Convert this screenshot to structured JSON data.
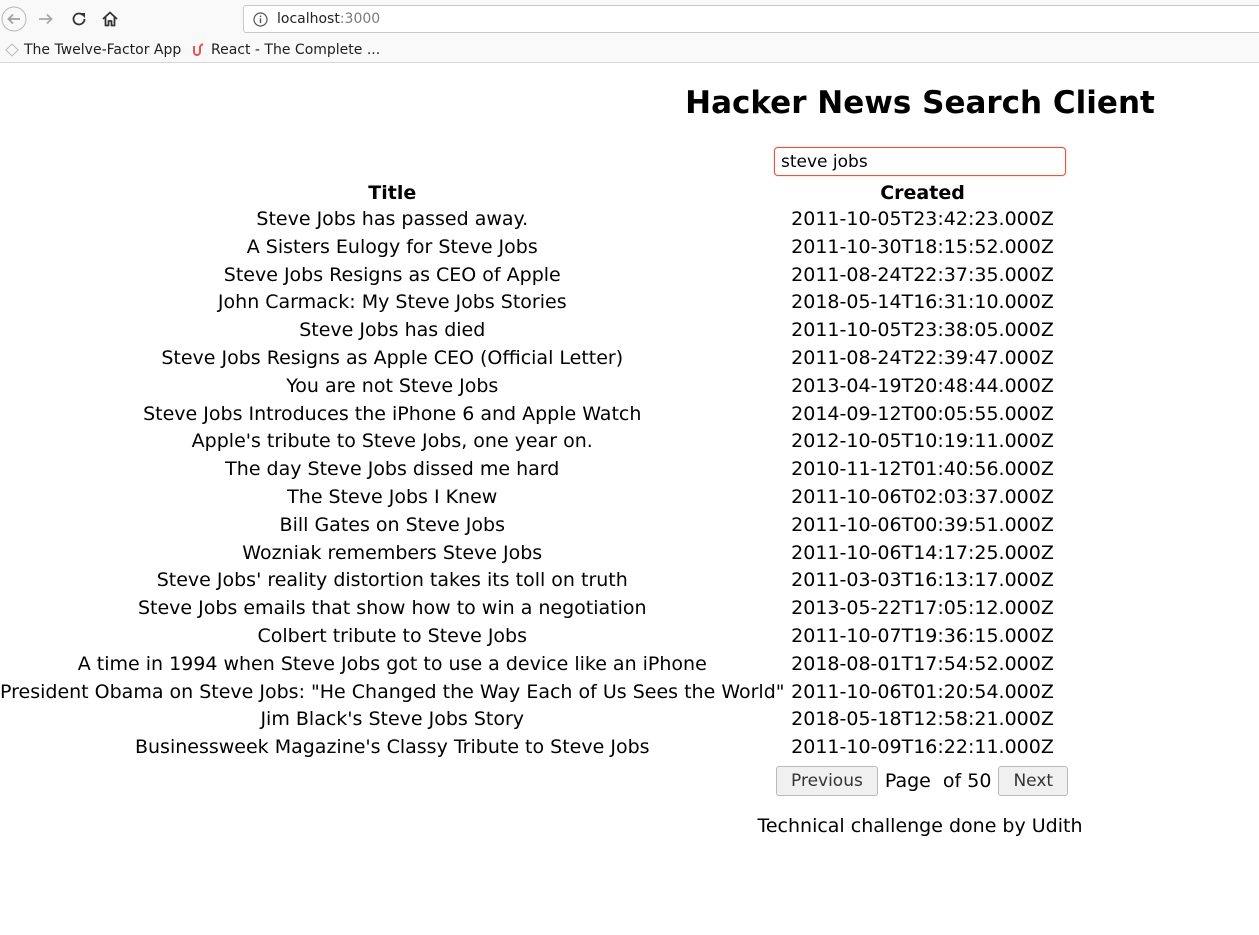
{
  "browser": {
    "url_host": "localhost",
    "url_port": ":3000",
    "bookmarks": [
      {
        "label": "The Twelve-Factor App",
        "icon": "twelve-factor-icon"
      },
      {
        "label": "React - The Complete ...",
        "icon": "udemy-icon"
      }
    ]
  },
  "app": {
    "title": "Hacker News Search Client",
    "search": {
      "value": "steve jobs"
    },
    "table": {
      "headers": {
        "title": "Title",
        "created": "Created"
      },
      "rows": [
        {
          "title": "Steve Jobs has passed away.",
          "created": "2011-10-05T23:42:23.000Z"
        },
        {
          "title": "A Sisters Eulogy for Steve Jobs",
          "created": "2011-10-30T18:15:52.000Z"
        },
        {
          "title": "Steve Jobs Resigns as CEO of Apple",
          "created": "2011-08-24T22:37:35.000Z"
        },
        {
          "title": "John Carmack: My Steve Jobs Stories",
          "created": "2018-05-14T16:31:10.000Z"
        },
        {
          "title": "Steve Jobs has died",
          "created": "2011-10-05T23:38:05.000Z"
        },
        {
          "title": "Steve Jobs Resigns as Apple CEO (Official Letter)",
          "created": "2011-08-24T22:39:47.000Z"
        },
        {
          "title": "You are not Steve Jobs",
          "created": "2013-04-19T20:48:44.000Z"
        },
        {
          "title": "Steve Jobs Introduces the iPhone 6 and Apple Watch",
          "created": "2014-09-12T00:05:55.000Z"
        },
        {
          "title": "Apple's tribute to Steve Jobs, one year on.",
          "created": "2012-10-05T10:19:11.000Z"
        },
        {
          "title": "The day Steve Jobs dissed me hard",
          "created": "2010-11-12T01:40:56.000Z"
        },
        {
          "title": "The Steve Jobs I Knew",
          "created": "2011-10-06T02:03:37.000Z"
        },
        {
          "title": "Bill Gates on Steve Jobs",
          "created": "2011-10-06T00:39:51.000Z"
        },
        {
          "title": "Wozniak remembers Steve Jobs",
          "created": "2011-10-06T14:17:25.000Z"
        },
        {
          "title": "Steve Jobs' reality distortion takes its toll on truth",
          "created": "2011-03-03T16:13:17.000Z"
        },
        {
          "title": "Steve Jobs emails that show how to win a negotiation",
          "created": "2013-05-22T17:05:12.000Z"
        },
        {
          "title": "Colbert tribute to Steve Jobs",
          "created": "2011-10-07T19:36:15.000Z"
        },
        {
          "title": "A time in 1994 when Steve Jobs got to use a device like an iPhone",
          "created": "2018-08-01T17:54:52.000Z"
        },
        {
          "title": "President Obama on Steve Jobs: \"He Changed the Way Each of Us Sees the World\"",
          "created": "2011-10-06T01:20:54.000Z"
        },
        {
          "title": "Jim Black's Steve Jobs Story",
          "created": "2018-05-18T12:58:21.000Z"
        },
        {
          "title": "Businessweek Magazine's Classy Tribute to Steve Jobs",
          "created": "2011-10-09T16:22:11.000Z"
        }
      ]
    },
    "pager": {
      "previous_label": "Previous",
      "page_label": "Page  of 50",
      "next_label": "Next"
    },
    "footer": "Technical challenge done by Udith"
  }
}
